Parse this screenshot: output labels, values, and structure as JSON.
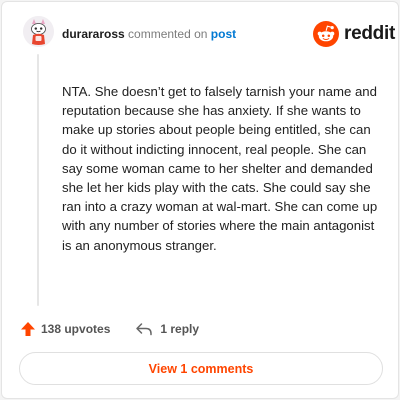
{
  "comment": {
    "username": "duraraross",
    "action_text": "commented on",
    "target_link": "post",
    "body": "NTA. She doesn’t get to falsely tarnish your name and reputation because she has anxiety. If she wants to make up stories about people being entitled, she can do it without indicting innocent, real people. She can say some woman came to her shelter and demanded she let her kids play with the cats. She could say she ran into a crazy woman at wal-mart. She can come up with any number of stories where the main antagonist is an anonymous stranger.",
    "upvotes_label": "138 upvotes",
    "replies_label": "1 reply",
    "view_comments_label": "View 1 comments"
  },
  "brand": {
    "wordmark": "reddit",
    "accent_color": "#ff4500",
    "logo_icon": "reddit-snoo-icon"
  },
  "icons": {
    "upvote": "upvote-arrow-icon",
    "reply": "reply-arrow-icon",
    "avatar": "snoo-avatar-icon"
  }
}
